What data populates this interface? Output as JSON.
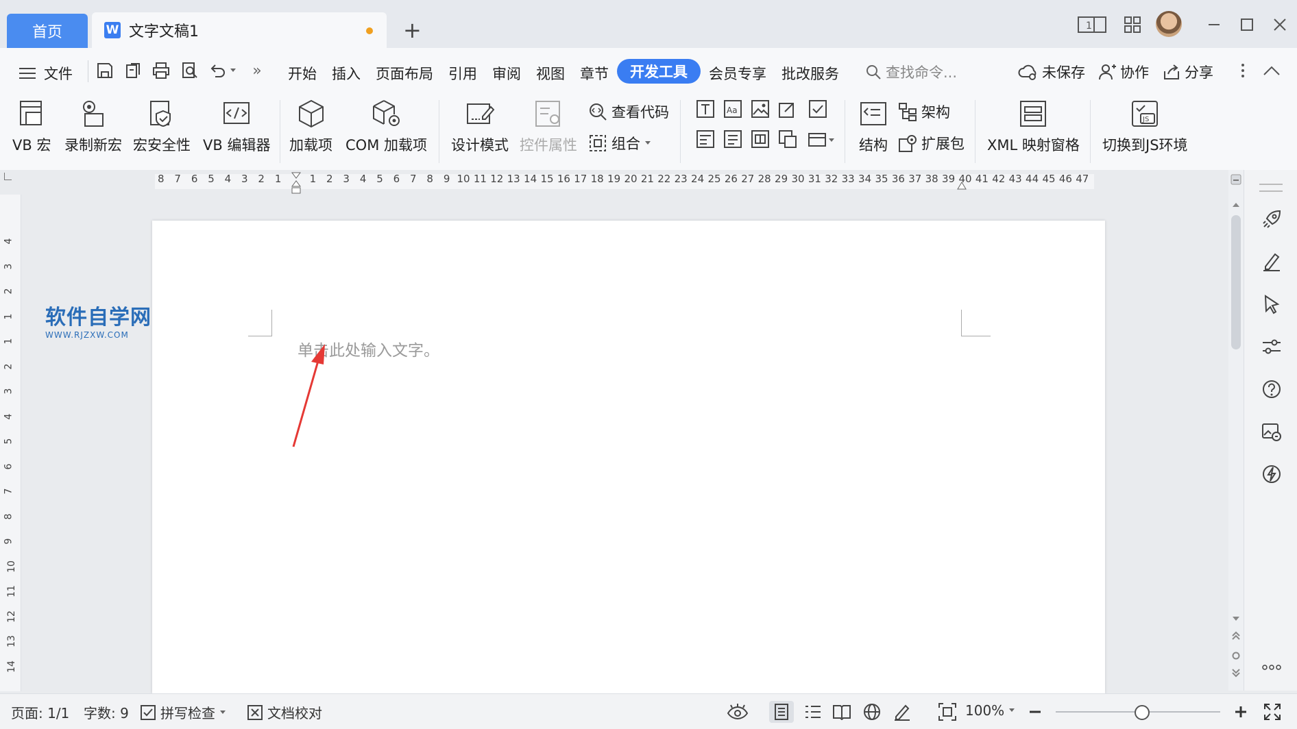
{
  "titlebar": {
    "home_tab": "首页",
    "doc_tab": "文字文稿1",
    "doc_icon_letter": "W",
    "add_tab": "+"
  },
  "menubar": {
    "file": "文件",
    "overflow": "»",
    "tabs": [
      "开始",
      "插入",
      "页面布局",
      "引用",
      "审阅",
      "视图",
      "章节",
      "开发工具",
      "会员专享",
      "批改服务"
    ],
    "active_tab": "开发工具",
    "search_placeholder": "查找命令...",
    "unsaved": "未保存",
    "collaborate": "协作",
    "share": "分享"
  },
  "ribbon": {
    "vb_macro": "VB 宏",
    "record_macro": "录制新宏",
    "macro_security": "宏安全性",
    "vb_editor": "VB 编辑器",
    "addins": "加载项",
    "com_addins": "COM 加载项",
    "design_mode": "设计模式",
    "control_props": "控件属性",
    "view_code": "查看代码",
    "group": "组合",
    "structure": "结构",
    "schema": "架构",
    "expansion": "扩展包",
    "xml_pane": "XML 映射窗格",
    "switch_js": "切换到JS环境"
  },
  "ruler": {
    "left_numbers": [
      "8",
      "7",
      "6",
      "5",
      "4",
      "3",
      "2",
      "1"
    ],
    "right_numbers": [
      "1",
      "2",
      "3",
      "4",
      "5",
      "6",
      "7",
      "8",
      "9",
      "10",
      "11",
      "12",
      "13",
      "14",
      "15",
      "16",
      "17",
      "18",
      "19",
      "20",
      "21",
      "22",
      "23",
      "24",
      "25",
      "26",
      "27",
      "28",
      "29",
      "30",
      "31",
      "32",
      "33",
      "34",
      "35",
      "36",
      "37",
      "38",
      "39",
      "40",
      "41",
      "42",
      "43",
      "44",
      "45",
      "46",
      "47"
    ],
    "vertical_numbers": [
      "4",
      "3",
      "2",
      "1",
      "1",
      "2",
      "3",
      "4",
      "5",
      "6",
      "7",
      "8",
      "9",
      "10",
      "11",
      "12",
      "13",
      "14"
    ]
  },
  "document": {
    "placeholder": "单击此处输入文字。",
    "watermark_title": "软件自学网",
    "watermark_sub": "WWW.RJZXW.COM",
    "arrow_color": "#e53935"
  },
  "statusbar": {
    "page": "页面: 1/1",
    "word_count": "字数: 9",
    "spell_check": "拼写检查",
    "proofread": "文档校对",
    "zoom": "100%"
  },
  "colors": {
    "accent": "#3a7df2",
    "home_tab": "#4a8cf0"
  }
}
